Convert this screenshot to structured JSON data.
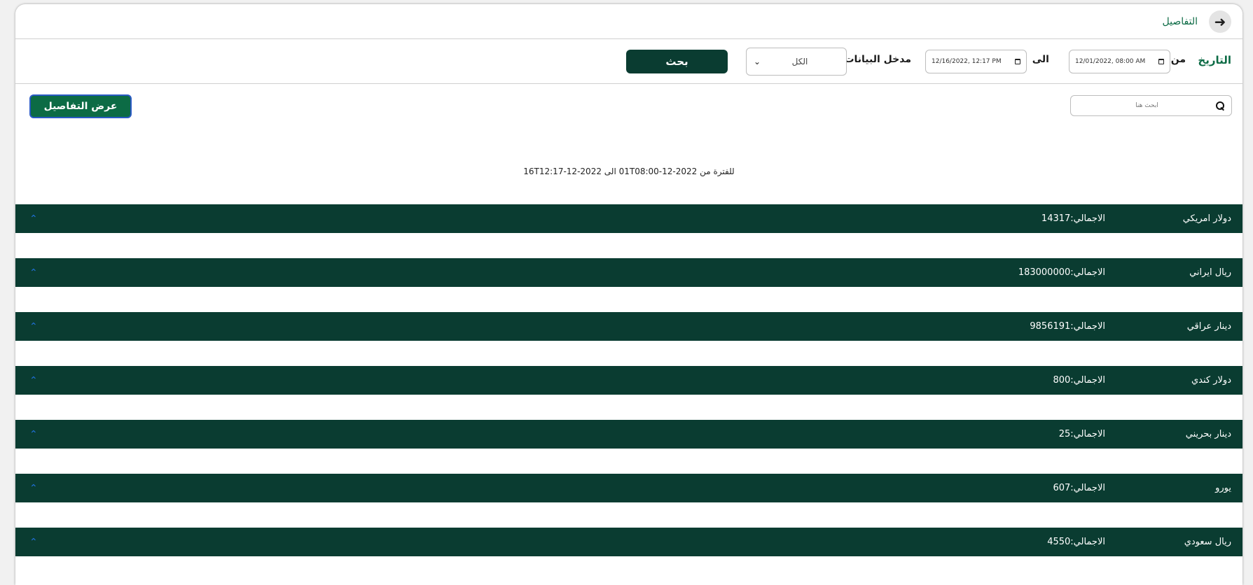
{
  "header": {
    "title": "التفاصيل",
    "back_icon": "arrow-right-icon"
  },
  "filters": {
    "date_label": "التاريخ",
    "from_label": "من",
    "from_value": "12/01/2022, 08:00 AM",
    "to_label": "الى",
    "to_value": "12/16/2022, 12:17 PM",
    "data_entry_label": "مدخل البيانات",
    "data_entry_selected": "الكل",
    "search_button": "بحث"
  },
  "search": {
    "placeholder": "ابحث هنا"
  },
  "details_button": "عرض التفاصيل",
  "period_text": "للفترة من 2022-12-01T08:00 الى 2022-12-16T12:17",
  "currencies": [
    {
      "name": "دولار امريكي",
      "total": "الاجمالي:14317"
    },
    {
      "name": "ريال ايراني",
      "total": "الاجمالي:183000000"
    },
    {
      "name": "دينار عراقي",
      "total": "الاجمالي:9856191"
    },
    {
      "name": "دولار كندي",
      "total": "الاجمالي:800"
    },
    {
      "name": "دينار بحريني",
      "total": "الاجمالي:25"
    },
    {
      "name": "يورو",
      "total": "الاجمالي:607"
    },
    {
      "name": "ريال سعودي",
      "total": "الاجمالي:4550"
    }
  ],
  "colors": {
    "primary_dark": "#0a3c31",
    "primary_green": "#0c6b45",
    "caret_blue": "#1f6fd6"
  }
}
